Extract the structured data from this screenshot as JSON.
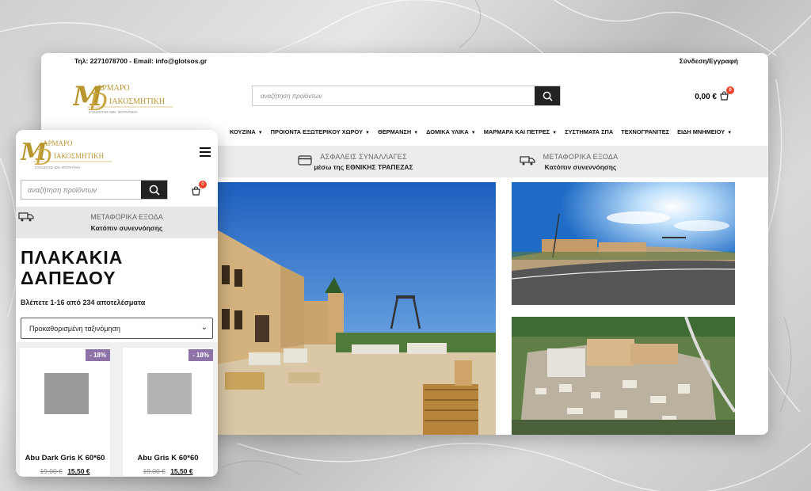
{
  "desktop": {
    "topbar": {
      "contact": "Τηλ: 2271078700 - Email: info@glotsos.gr",
      "login": "Σύνδεση/Εγγραφή"
    },
    "logo": {
      "main": "ΑΡΜΑΡΟ ΙΑΚΟΣΜΗΤΙΚΗ",
      "sub": "ΣΥΚΟΣΙΤΗΣ ΙΩΝ. ΦΟΥΝΤΑΚΗ"
    },
    "search": {
      "placeholder": "αναζήτηση προϊόντων"
    },
    "cart": {
      "total": "0,00 €",
      "count": "0"
    },
    "nav": [
      {
        "label": "ΚΟΥΖΙΝΑ",
        "caret": true
      },
      {
        "label": "ΠΡΟΙΟΝΤΑ ΕΞΩΤΕΡΙΚΟΥ ΧΩΡΟΥ",
        "caret": true
      },
      {
        "label": "ΘΕΡΜΑΝΣΗ",
        "caret": true
      },
      {
        "label": "ΔΟΜΙΚΑ ΥΛΙΚΑ",
        "caret": true
      },
      {
        "label": "ΜΑΡΜΑΡΑ ΚΑΙ ΠΕΤΡΕΣ",
        "caret": true
      },
      {
        "label": "ΣΥΣΤΗΜΑΤΑ ΣΠΑ",
        "caret": false
      },
      {
        "label": "ΤΕΧΝΟΓΡΑΝΙΤΕΣ",
        "caret": false
      },
      {
        "label": "ΕΙΔΗ ΜΝΗΜΕΙΟΥ",
        "caret": true
      }
    ],
    "info": [
      {
        "icon": "card-icon",
        "line1": "ΑΣΦΑΛΕΙΣ ΣΥΝΑΛΛΑΓΕΣ",
        "line2": "μέσω της ΕΘΝΙΚΗΣ ΤΡΑΠΕΖΑΣ"
      },
      {
        "icon": "truck-icon",
        "line1": "ΜΕΤΑΦΟΡΙΚΑ ΕΞΟΔΑ",
        "line2": "Κατόπιν συνεννόησης"
      }
    ]
  },
  "mobile": {
    "search": {
      "placeholder": "αναζήτηση προϊόντων"
    },
    "cart_count": "0",
    "info": {
      "line1": "ΜΕΤΑΦΟΡΙΚΑ ΕΞΟΔΑ",
      "line2": "Κατόπιν συνεννόησης"
    },
    "title_line1": "ΠΛΑΚΑΚΙΑ",
    "title_line2": "ΔΑΠΕΔΟΥ",
    "results": "Βλέπετε 1-16 από 234 αποτελέσματα",
    "sort": "Προκαθορισμένη ταξινόμηση",
    "products": [
      {
        "discount": "- 18%",
        "name": "Abu Dark Gris K 60*60",
        "old_price": "19,00 €",
        "new_price": "15,50 €",
        "swatch": "#9a9a9c"
      },
      {
        "discount": "- 18%",
        "name": "Abu Gris K 60*60",
        "old_price": "19,00 €",
        "new_price": "15,50 €",
        "swatch": "#b4b4b6"
      }
    ]
  },
  "colors": {
    "accent_badge": "#e8452c",
    "discount": "#8e73a8",
    "logo_gold": "#b8962e"
  }
}
